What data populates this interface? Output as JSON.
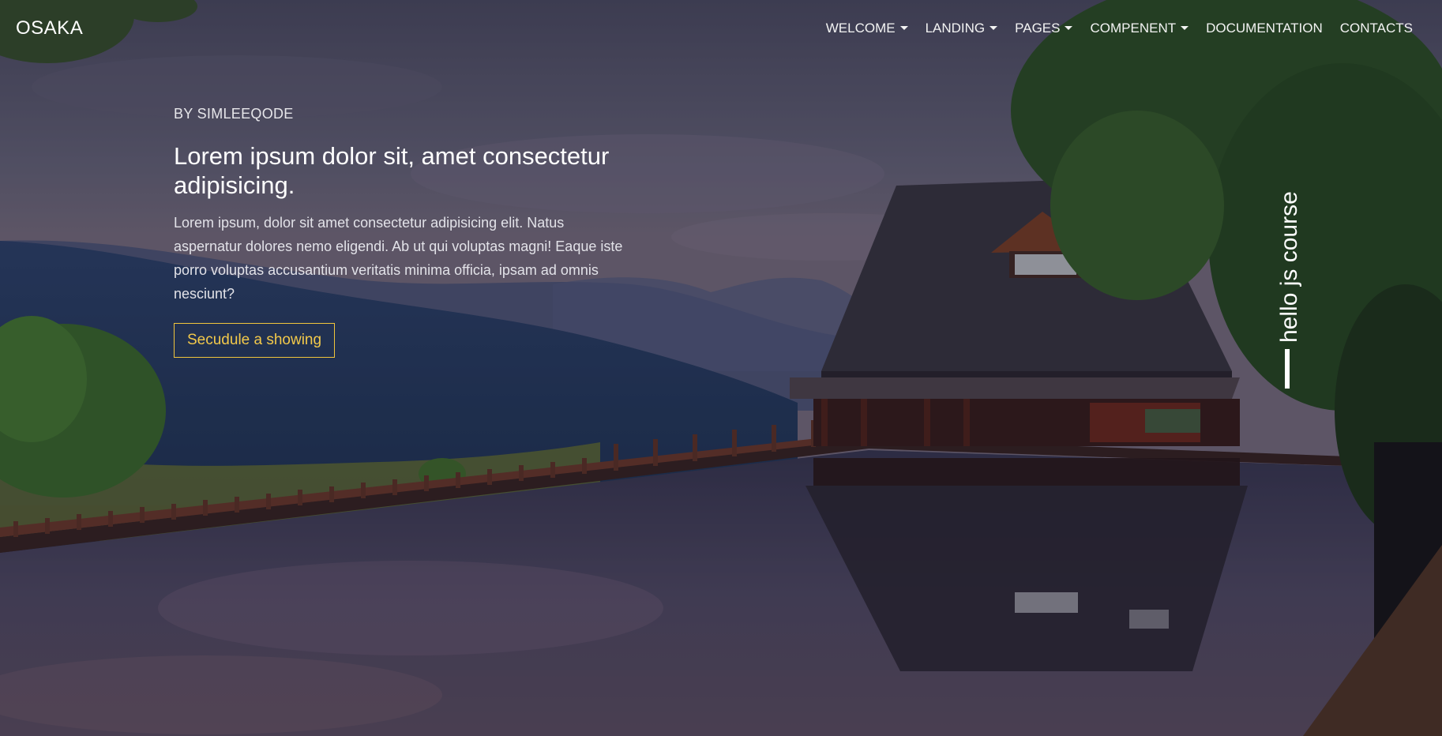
{
  "brand": "OSAKA",
  "nav": {
    "items": [
      {
        "label": "WELCOME",
        "dropdown": true
      },
      {
        "label": "LANDING",
        "dropdown": true
      },
      {
        "label": "PAGES",
        "dropdown": true
      },
      {
        "label": "COMPENENT",
        "dropdown": true
      },
      {
        "label": "DOCUMENTATION",
        "dropdown": false
      },
      {
        "label": "CONTACTS",
        "dropdown": false
      }
    ]
  },
  "hero": {
    "byline": "BY SIMLEEQODE",
    "headline": "Lorem ipsum dolor sit, amet consectetur adipisicing.",
    "lead": "Lorem ipsum, dolor sit amet consectetur adipisicing elit. Natus aspernatur dolores nemo eligendi. Ab ut qui voluptas magni! Eaque iste porro voluptas accusantium veritatis minima officia, ipsam ad omnis nesciunt?",
    "cta_label": "Secudule a showing"
  },
  "side_label": "hello js course",
  "colors": {
    "accent": "#f0c53c",
    "overlay": "#141223"
  }
}
